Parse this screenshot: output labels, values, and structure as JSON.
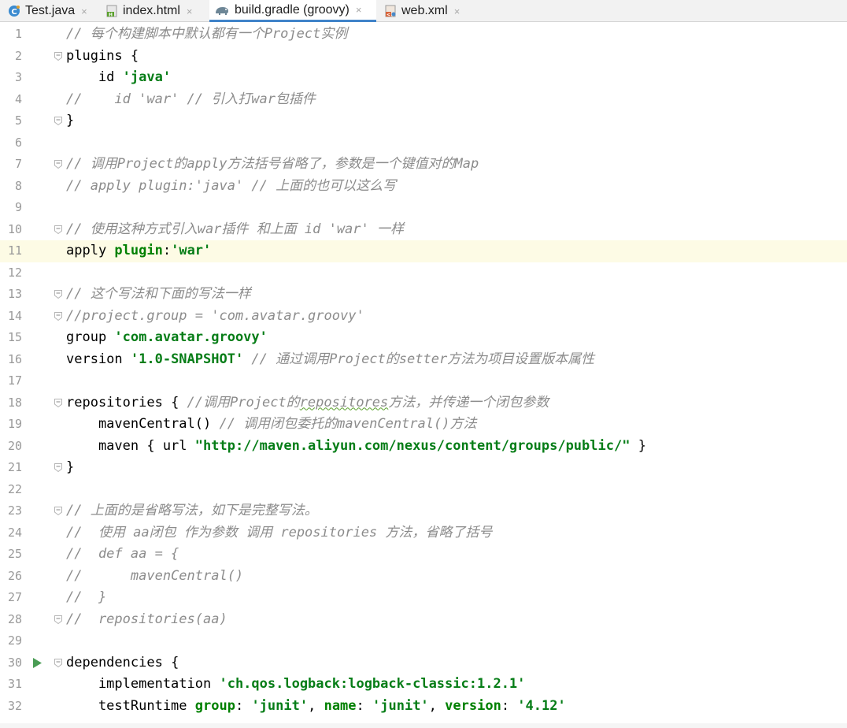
{
  "tabs": [
    {
      "label": "Test.java",
      "icon": "java-class-icon",
      "active": false
    },
    {
      "label": "index.html",
      "icon": "html-file-icon",
      "active": false
    },
    {
      "label": "build.gradle (groovy)",
      "icon": "gradle-elephant-icon",
      "active": true
    },
    {
      "label": "web.xml",
      "icon": "xml-file-icon",
      "active": false
    }
  ],
  "close_glyph": "×",
  "highlighted_line": 11,
  "lines": [
    {
      "n": "1",
      "segs": [
        {
          "t": "// 每个构建脚本中默认都有一个Project实例",
          "c": "cm"
        }
      ]
    },
    {
      "n": "2",
      "fold": true,
      "segs": [
        {
          "t": "plugins ",
          "c": "plain"
        },
        {
          "t": "{",
          "c": "plain"
        }
      ]
    },
    {
      "n": "3",
      "segs": [
        {
          "t": "    id ",
          "c": "plain"
        },
        {
          "t": "'java'",
          "c": "str"
        }
      ]
    },
    {
      "n": "4",
      "segs": [
        {
          "t": "//    id 'war' // 引入打war包插件",
          "c": "cm"
        }
      ]
    },
    {
      "n": "5",
      "fold": true,
      "segs": [
        {
          "t": "}",
          "c": "plain"
        }
      ]
    },
    {
      "n": "6",
      "segs": []
    },
    {
      "n": "7",
      "fold": true,
      "segs": [
        {
          "t": "// 调用Project的apply方法括号省略了，参数是一个键值对的Map",
          "c": "cm"
        }
      ]
    },
    {
      "n": "8",
      "segs": [
        {
          "t": "// apply plugin:'java' // 上面的也可以这么写",
          "c": "cm"
        }
      ]
    },
    {
      "n": "9",
      "segs": []
    },
    {
      "n": "10",
      "fold": true,
      "segs": [
        {
          "t": "// 使用这种方式引入war插件 和上面 id 'war' 一样",
          "c": "cm"
        }
      ]
    },
    {
      "n": "11",
      "segs": [
        {
          "t": "apply ",
          "c": "plain"
        },
        {
          "t": "plugin",
          "c": "named"
        },
        {
          "t": ":",
          "c": "plain"
        },
        {
          "t": "'war'",
          "c": "str"
        }
      ]
    },
    {
      "n": "12",
      "segs": []
    },
    {
      "n": "13",
      "fold": true,
      "segs": [
        {
          "t": "// 这个写法和下面的写法一样",
          "c": "cm"
        }
      ]
    },
    {
      "n": "14",
      "fold": true,
      "segs": [
        {
          "t": "//project.group = 'com.avatar.groovy'",
          "c": "cm"
        }
      ]
    },
    {
      "n": "15",
      "segs": [
        {
          "t": "group ",
          "c": "plain"
        },
        {
          "t": "'com.avatar.groovy'",
          "c": "str"
        }
      ]
    },
    {
      "n": "16",
      "segs": [
        {
          "t": "version ",
          "c": "plain"
        },
        {
          "t": "'1.0-SNAPSHOT'",
          "c": "str"
        },
        {
          "t": " // 通过调用Project的setter方法为项目设置版本属性",
          "c": "cm"
        }
      ]
    },
    {
      "n": "17",
      "segs": []
    },
    {
      "n": "18",
      "fold": true,
      "segs": [
        {
          "t": "repositories ",
          "c": "plain"
        },
        {
          "t": "{",
          "c": "plain"
        },
        {
          "t": " //调用Project的",
          "c": "cm"
        },
        {
          "t": "repositores",
          "c": "cm squig"
        },
        {
          "t": "方法，并传递一个闭包参数",
          "c": "cm"
        }
      ]
    },
    {
      "n": "19",
      "segs": [
        {
          "t": "    mavenCentral() ",
          "c": "plain"
        },
        {
          "t": "// 调用闭包委托的mavenCentral()方法",
          "c": "cm"
        }
      ]
    },
    {
      "n": "20",
      "segs": [
        {
          "t": "    maven { url ",
          "c": "plain"
        },
        {
          "t": "\"http://maven.aliyun.com/nexus/content/groups/public/\"",
          "c": "str"
        },
        {
          "t": " }",
          "c": "plain"
        }
      ]
    },
    {
      "n": "21",
      "fold": true,
      "segs": [
        {
          "t": "}",
          "c": "plain"
        }
      ]
    },
    {
      "n": "22",
      "segs": []
    },
    {
      "n": "23",
      "fold": true,
      "segs": [
        {
          "t": "// 上面的是省略写法，如下是完整写法。",
          "c": "cm"
        }
      ]
    },
    {
      "n": "24",
      "segs": [
        {
          "t": "//  使用 aa闭包 作为参数 调用 repositories 方法，省略了括号",
          "c": "cm"
        }
      ]
    },
    {
      "n": "25",
      "segs": [
        {
          "t": "//  def aa = {",
          "c": "cm"
        }
      ]
    },
    {
      "n": "26",
      "segs": [
        {
          "t": "//      mavenCentral()",
          "c": "cm"
        }
      ]
    },
    {
      "n": "27",
      "segs": [
        {
          "t": "//  }",
          "c": "cm"
        }
      ]
    },
    {
      "n": "28",
      "fold": true,
      "segs": [
        {
          "t": "//  repositories(aa)",
          "c": "cm"
        }
      ]
    },
    {
      "n": "29",
      "segs": []
    },
    {
      "n": "30",
      "fold": true,
      "run": true,
      "segs": [
        {
          "t": "dependencies ",
          "c": "plain"
        },
        {
          "t": "{",
          "c": "plain"
        }
      ]
    },
    {
      "n": "31",
      "segs": [
        {
          "t": "    implementation ",
          "c": "plain"
        },
        {
          "t": "'ch.qos.logback:logback-classic:1.2.1'",
          "c": "str"
        }
      ]
    },
    {
      "n": "32",
      "segs": [
        {
          "t": "    testRuntime ",
          "c": "plain"
        },
        {
          "t": "group",
          "c": "named"
        },
        {
          "t": ": ",
          "c": "plain"
        },
        {
          "t": "'junit'",
          "c": "str"
        },
        {
          "t": ", ",
          "c": "plain"
        },
        {
          "t": "name",
          "c": "named"
        },
        {
          "t": ": ",
          "c": "plain"
        },
        {
          "t": "'junit'",
          "c": "str"
        },
        {
          "t": ", ",
          "c": "plain"
        },
        {
          "t": "version",
          "c": "named"
        },
        {
          "t": ": ",
          "c": "plain"
        },
        {
          "t": "'4.12'",
          "c": "str"
        }
      ]
    }
  ],
  "colors": {
    "accent": "#4083c9",
    "string": "#067d17",
    "comment": "#8c8c8c",
    "current_line": "#fdfbe5",
    "run_icon": "#499c54"
  }
}
